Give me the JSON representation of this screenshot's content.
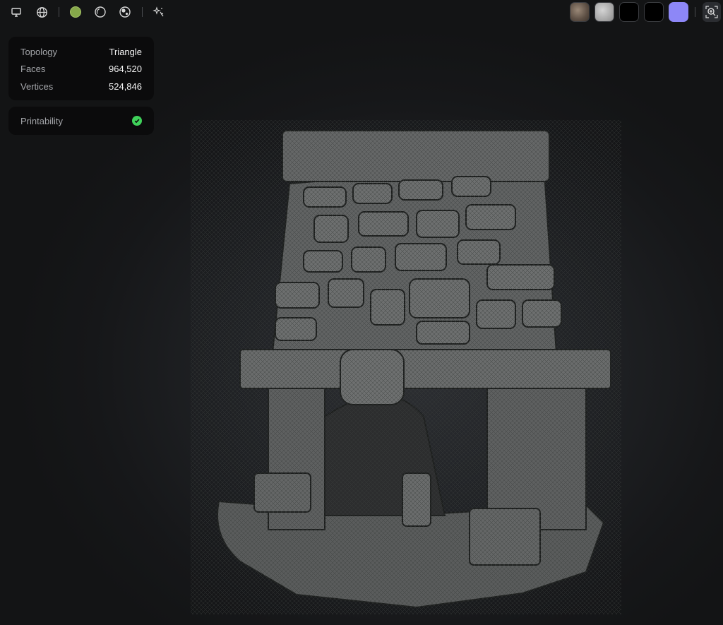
{
  "toolbar": {
    "icons": [
      "monitor-icon",
      "globe-icon",
      "shaded-sphere-icon",
      "outline-sphere-icon",
      "matcap-sphere-icon",
      "sparkle-icon",
      "zoom-fit-icon"
    ],
    "swatches": [
      {
        "name": "texture-rock",
        "color": "#6e5f52"
      },
      {
        "name": "texture-concrete",
        "color": "#b9b9b9"
      },
      {
        "name": "black-1",
        "color": "#000000"
      },
      {
        "name": "black-2",
        "color": "#000000"
      },
      {
        "name": "periwinkle",
        "color": "#8d87f7"
      }
    ],
    "active_sphere_color": "#86a84a"
  },
  "stats": {
    "topology_label": "Topology",
    "topology_value": "Triangle",
    "faces_label": "Faces",
    "faces_value": "964,520",
    "vertices_label": "Vertices",
    "vertices_value": "524,846"
  },
  "printability": {
    "label": "Printability",
    "status_color": "#3fd15a"
  },
  "viewport": {
    "model_color": "#5d5f60",
    "wire_color": "#2a2d2c"
  }
}
